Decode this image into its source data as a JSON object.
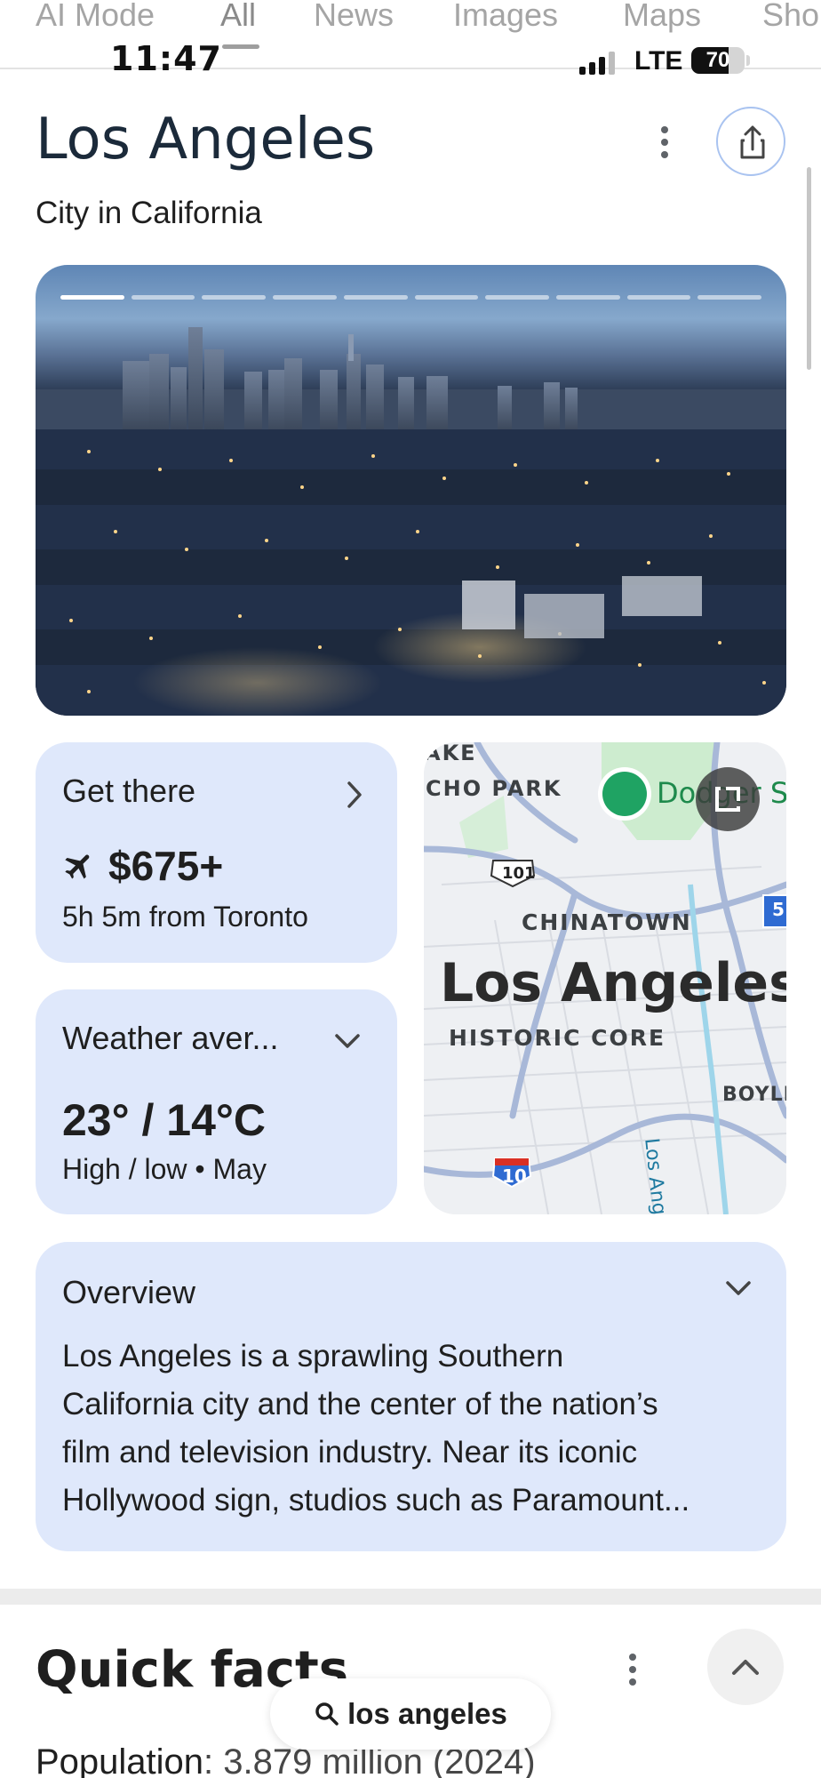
{
  "tabs": [
    "AI Mode",
    "All",
    "News",
    "Images",
    "Maps",
    "Sho"
  ],
  "active_tab": "All",
  "status_bar": {
    "time": "11:47",
    "network": "LTE",
    "battery": "70"
  },
  "entity": {
    "title": "Los Angeles",
    "subtitle": "City in California"
  },
  "gallery": {
    "slide_count": 10,
    "current_slide": 1
  },
  "get_there": {
    "title": "Get there",
    "price": "$675+",
    "detail": "5h 5m from Toronto"
  },
  "weather": {
    "title": "Weather aver...",
    "temps": "23° / 14°C",
    "detail": "High / low • May"
  },
  "map": {
    "labels": {
      "lake": "AKE",
      "echo_park": "CHO PARK",
      "dodger": "Dodger S",
      "chinatown": "CHINATOWN",
      "city": "Los Angeles",
      "historic": "HISTORIC CORE",
      "boyle": "BOYLI",
      "river": "Los Angeles R",
      "hwy101": "101",
      "hwy10": "10",
      "hwy5": "5"
    }
  },
  "overview": {
    "title": "Overview",
    "lines": [
      "Los Angeles is a sprawling Southern",
      "California city and the center of the nation’s",
      "film and television industry. Near its iconic",
      "Hollywood sign, studios such as Paramount..."
    ]
  },
  "quick_facts": {
    "title": "Quick facts",
    "population_label": "Population",
    "population_value": ": 3.879 million (2024)"
  },
  "search_pill": {
    "query": "los angeles"
  },
  "colors": {
    "card_bg": "#dfe8fb",
    "accent": "#a9c3f0"
  }
}
